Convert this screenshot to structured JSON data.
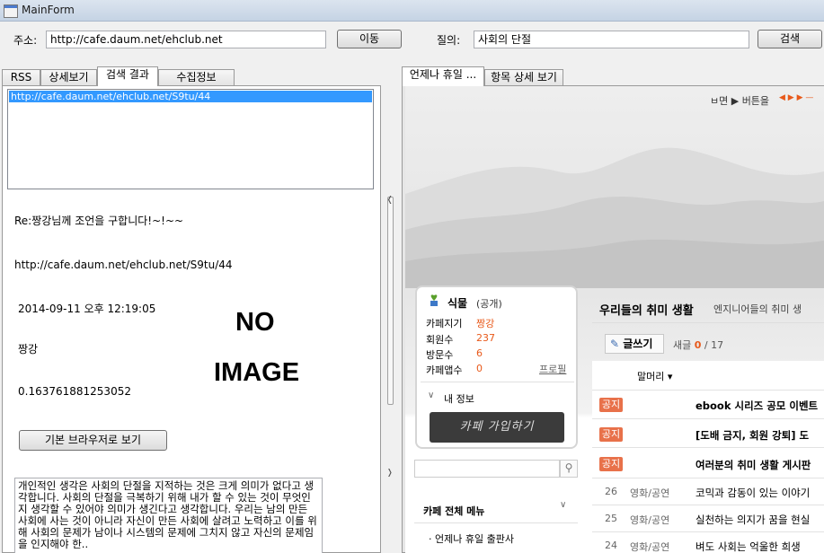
{
  "window": {
    "title": "MainForm"
  },
  "toolbar": {
    "address_label": "주소:",
    "address_value": "http://cafe.daum.net/ehclub.net",
    "go_button": "이동",
    "query_label": "질의:",
    "query_value": "사회의 단절",
    "search_button": "검색"
  },
  "left_tabs": [
    "RSS",
    "상세보기",
    "검색 결과",
    "수집정보"
  ],
  "left_active_tab": "검색 결과",
  "results": {
    "selected_url": "http://cafe.daum.net/ehclub.net/S9tu/44"
  },
  "detail": {
    "title": "Re:짱강님께 조언을 구합니다!~!~~",
    "url": "http://cafe.daum.net/ehclub.net/S9tu/44",
    "date": "2014-09-11 오후 12:19:05",
    "author": "짱강",
    "score": "0.163761881253052",
    "no_image_line1": "NO",
    "no_image_line2": "IMAGE",
    "browser_button": "기본 브라우저로 보기",
    "description": "개인적인 생각은 사회의 단절을 지적하는 것은 크게 의미가 없다고 생각합니다. 사회의 단절을 극복하기 위해 내가 할 수 있는 것이 무엇인지 생각할 수 있어야 의미가 생긴다고 생각합니다. 우리는 남의 만든 사회에 사는 것이 아니라 자신이 만든 사회에 살려고 노력하고 이를 위해 사회의 문제가 남이나 시스템의 문제에 그치지 않고 자신의 문제임을 인지해야 한.."
  },
  "right_tabs": [
    "언제나 휴일 ...",
    "항목 상세 보기"
  ],
  "right_active_tab": "언제나 휴일 ...",
  "web": {
    "top_hint": "ㅂ면 ▶ 버튼을",
    "cafe": {
      "name": "식물",
      "visibility": "(공개)",
      "manager_label": "카페지기",
      "manager_value": "짱강",
      "members_label": "회원수",
      "members_value": "237",
      "visits_label": "방문수",
      "visits_value": "6",
      "apps_label": "카페앱수",
      "apps_value": "0",
      "profile_link": "프로필",
      "my_info": "내 정보",
      "join_button": "카페 가입하기"
    },
    "menu_title": "카페 전체 메뉴",
    "menu_item": "언제나 휴일 출판사",
    "board_title": "우리들의 취미 생활",
    "board_subtitle": "엔지니어들의 취미 생",
    "write_button": "글쓰기",
    "new_posts_label": "새글",
    "new_posts": "0",
    "total_posts": "/ 17",
    "header_col": "말머리 ▾",
    "posts": [
      {
        "badge": "공지",
        "no": "",
        "category": "",
        "title": "ebook 시리즈 공모 이벤트"
      },
      {
        "badge": "공지",
        "no": "",
        "category": "",
        "title": "[도배 금지, 회원 강퇴] 도"
      },
      {
        "badge": "공지",
        "no": "",
        "category": "",
        "title": "여러분의 취미 생활 게시판"
      },
      {
        "badge": "",
        "no": "26",
        "category": "영화/공연",
        "title": "코믹과 감동이 있는 이야기"
      },
      {
        "badge": "",
        "no": "25",
        "category": "영화/공연",
        "title": "실천하는 의지가 꿈을 현실"
      },
      {
        "badge": "",
        "no": "24",
        "category": "영화/공연",
        "title": "벼도 사회는 억울한 희생"
      }
    ]
  }
}
